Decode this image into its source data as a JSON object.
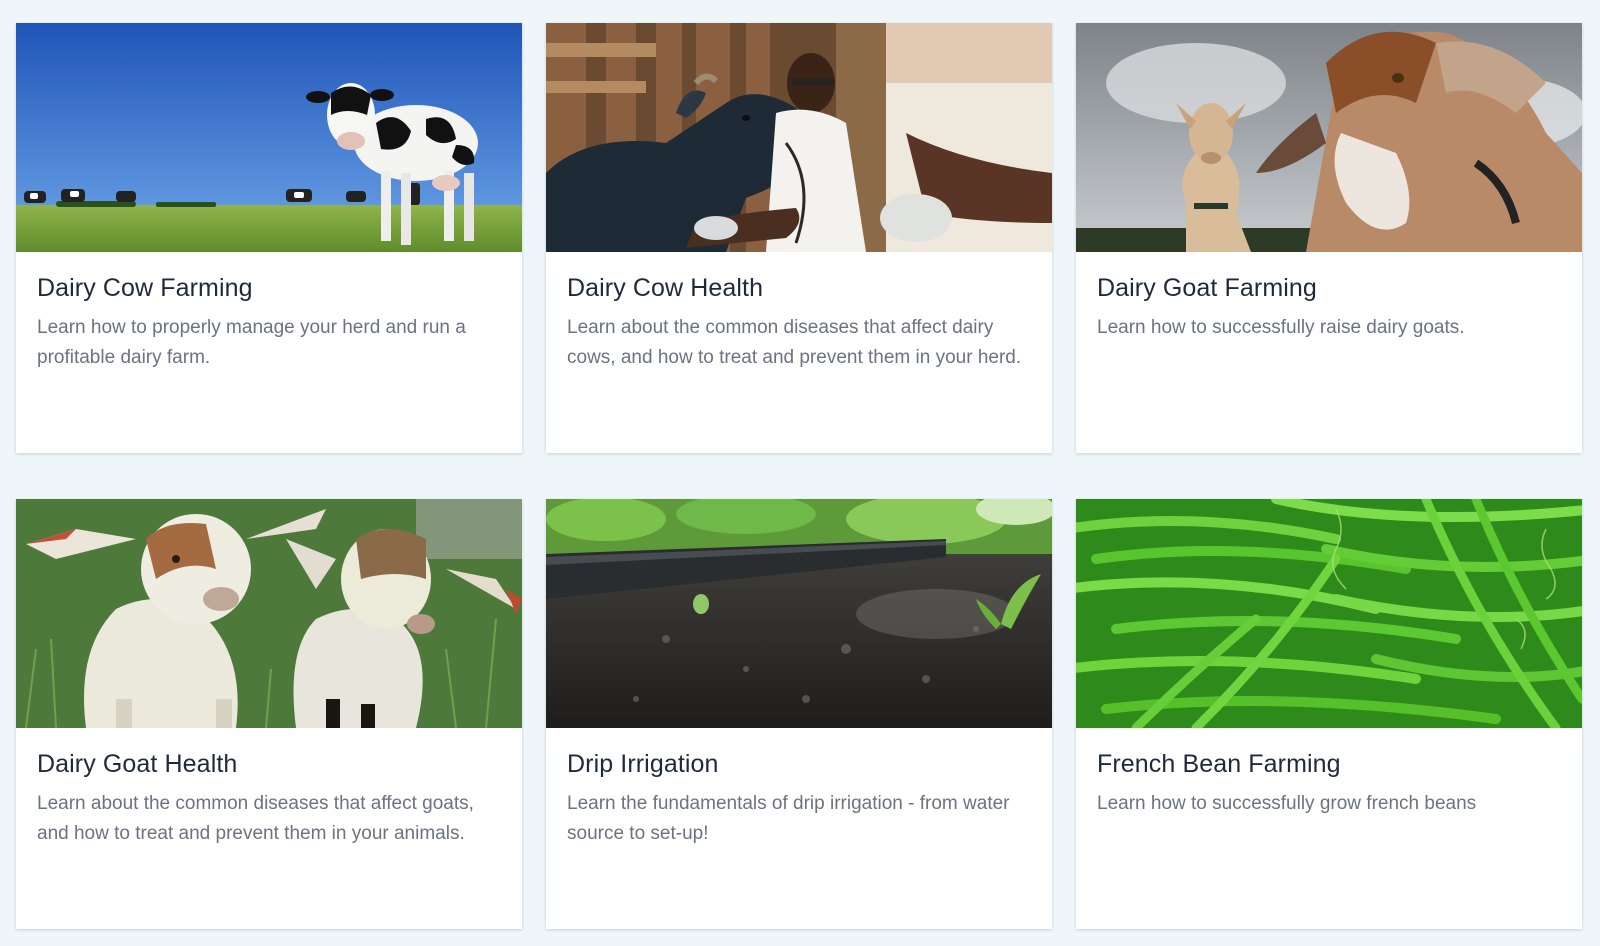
{
  "courses": [
    {
      "title": "Dairy Cow Farming",
      "description": "Learn how to properly manage your herd and run a profitable dairy farm."
    },
    {
      "title": "Dairy Cow Health",
      "description": "Learn about the common diseases that affect dairy cows, and how to treat and prevent them in your herd."
    },
    {
      "title": "Dairy Goat Farming",
      "description": "Learn how to successfully raise dairy goats."
    },
    {
      "title": "Dairy Goat Health",
      "description": "Learn about the common diseases that affect goats, and how to treat and prevent them in your animals."
    },
    {
      "title": "Drip Irrigation",
      "description": "Learn the fundamentals of drip irrigation - from water source to set-up!"
    },
    {
      "title": "French Bean Farming",
      "description": "Learn how to successfully grow french beans"
    }
  ]
}
